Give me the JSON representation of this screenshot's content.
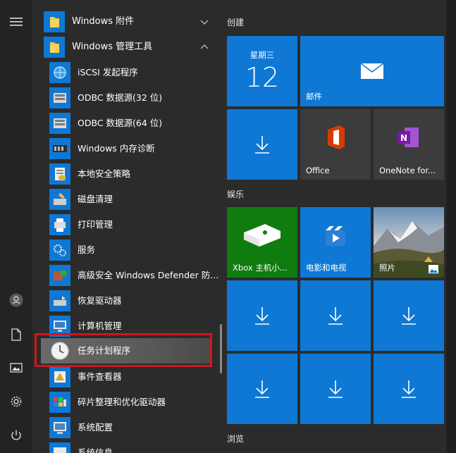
{
  "left_rail": {
    "icons": [
      "hamburger-menu-icon",
      "user-avatar-icon",
      "document-icon",
      "pictures-icon",
      "settings-gear-icon",
      "power-icon"
    ]
  },
  "app_list": {
    "folders": [
      {
        "label": "Windows 附件",
        "state": "collapsed"
      },
      {
        "label": "Windows 管理工具",
        "state": "expanded"
      }
    ],
    "items": [
      {
        "label": "iSCSI 发起程序"
      },
      {
        "label": "ODBC 数据源(32 位)"
      },
      {
        "label": "ODBC 数据源(64 位)"
      },
      {
        "label": "Windows 内存诊断"
      },
      {
        "label": "本地安全策略"
      },
      {
        "label": "磁盘清理"
      },
      {
        "label": "打印管理"
      },
      {
        "label": "服务"
      },
      {
        "label": "高级安全 Windows Defender 防..."
      },
      {
        "label": "恢复驱动器"
      },
      {
        "label": "计算机管理"
      },
      {
        "label": "任务计划程序",
        "highlighted": true
      },
      {
        "label": "事件查看器"
      },
      {
        "label": "碎片整理和优化驱动器"
      },
      {
        "label": "系统配置"
      },
      {
        "label": "系统信息"
      }
    ]
  },
  "tiles": {
    "groups": [
      {
        "title": "创建"
      },
      {
        "title": "娱乐"
      },
      {
        "title": "浏览"
      }
    ],
    "calendar": {
      "weekday": "星期三",
      "day": "12"
    },
    "mail_label": "邮件",
    "office_label": "Office",
    "onenote_label": "OneNote for...",
    "xbox_label": "Xbox 主机小...",
    "movies_label": "电影和电视",
    "photos_label": "照片"
  },
  "colors": {
    "tile_blue": "#0e78d4",
    "highlight_red": "#d0161f",
    "background": "#2b2b2b"
  }
}
